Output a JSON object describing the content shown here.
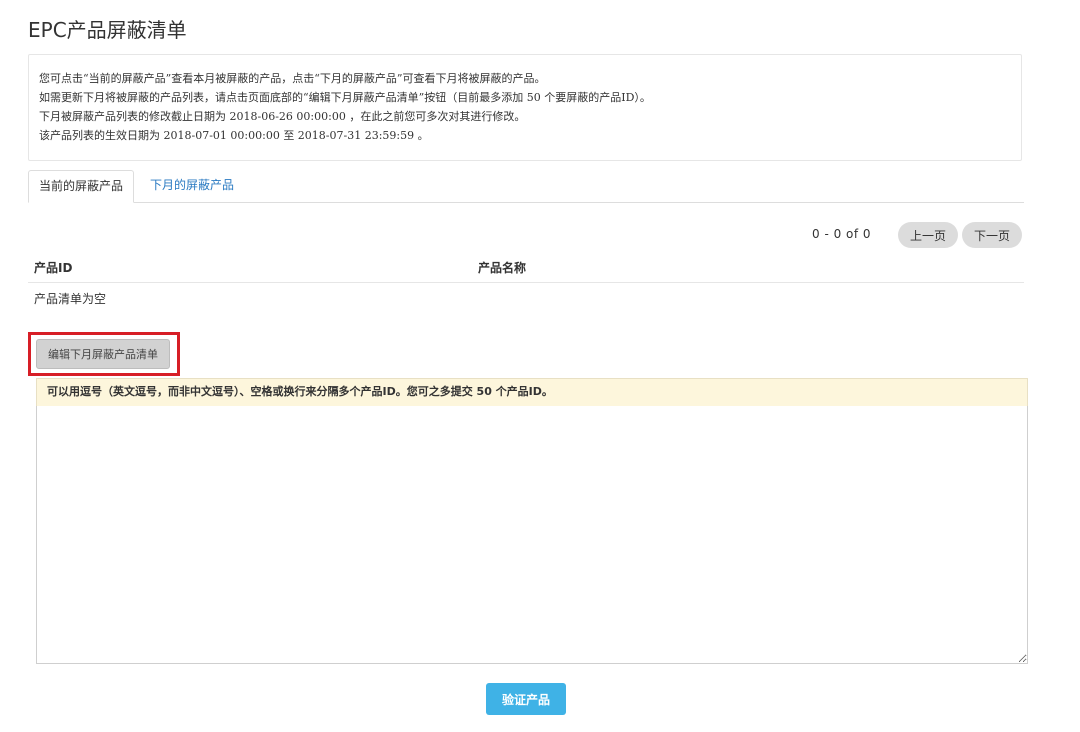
{
  "page": {
    "title": "EPC产品屏蔽清单"
  },
  "info": {
    "lines": [
      "您可点击“当前的屏蔽产品”查看本月被屏蔽的产品，点击“下月的屏蔽产品”可查看下月将被屏蔽的产品。",
      "如需更新下月将被屏蔽的产品列表，请点击页面底部的“编辑下月屏蔽产品清单”按钮（目前最多添加 50 个要屏蔽的产品ID）。",
      "下月被屏蔽产品列表的修改截止日期为 2018-06-26 00:00:00 ，在此之前您可多次对其进行修改。",
      "该产品列表的生效日期为 2018-07-01 00:00:00 至 2018-07-31 23:59:59 。"
    ]
  },
  "tabs": [
    {
      "label": "当前的屏蔽产品",
      "active": true
    },
    {
      "label": "下月的屏蔽产品",
      "active": false
    }
  ],
  "pager": {
    "range": "0 - 0 of 0",
    "prev_label": "上一页",
    "next_label": "下一页"
  },
  "table": {
    "columns": [
      "产品ID",
      "产品名称"
    ],
    "empty_text": "产品清单为空"
  },
  "edit": {
    "button_label": "编辑下月屏蔽产品清单"
  },
  "editor": {
    "hint": "可以用逗号（英文逗号，而非中文逗号）、空格或换行来分隔多个产品ID。您可之多提交 50 个产品ID。",
    "value": ""
  },
  "verify": {
    "button_label": "验证产品"
  },
  "colors": {
    "link": "#2a7ac2",
    "highlight": "#d71e26",
    "primary": "#3fb2e6",
    "hint_bg": "#fdf6dc"
  }
}
